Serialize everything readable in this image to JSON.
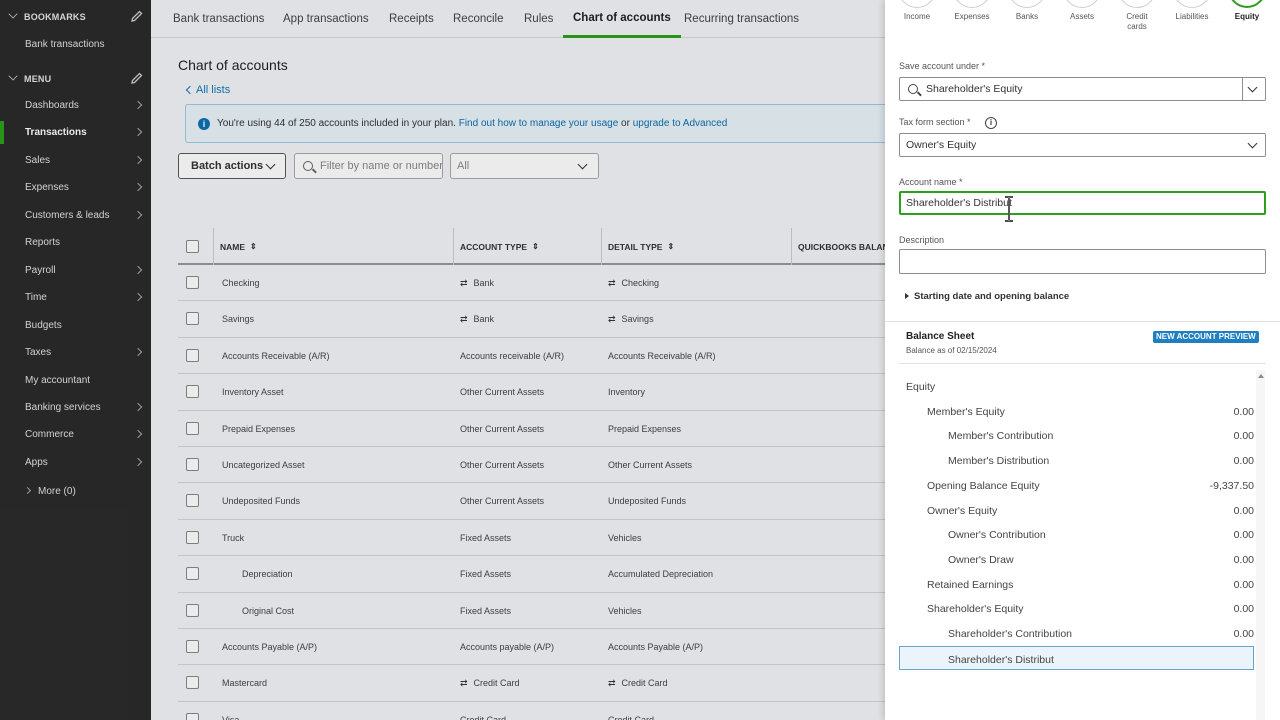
{
  "sidebar": {
    "bookmarks_label": "BOOKMARKS",
    "bookmark_items": [
      "Bank transactions"
    ],
    "menu_label": "MENU",
    "items": [
      {
        "label": "Dashboards",
        "arrow": true
      },
      {
        "label": "Transactions",
        "arrow": true,
        "active": true
      },
      {
        "label": "Sales",
        "arrow": true
      },
      {
        "label": "Expenses",
        "arrow": true
      },
      {
        "label": "Customers & leads",
        "arrow": true
      },
      {
        "label": "Reports",
        "arrow": false
      },
      {
        "label": "Payroll",
        "arrow": true
      },
      {
        "label": "Time",
        "arrow": true
      },
      {
        "label": "Budgets",
        "arrow": false
      },
      {
        "label": "Taxes",
        "arrow": true
      },
      {
        "label": "My accountant",
        "arrow": false
      },
      {
        "label": "Banking services",
        "arrow": true
      },
      {
        "label": "Commerce",
        "arrow": true
      },
      {
        "label": "Apps",
        "arrow": true
      }
    ],
    "more_label": "More (0)"
  },
  "tabs": [
    "Bank transactions",
    "App transactions",
    "Receipts",
    "Reconcile",
    "Rules",
    "Chart of accounts",
    "Recurring transactions"
  ],
  "selected_tab": "Chart of accounts",
  "page": {
    "title": "Chart of accounts",
    "all_lists": "All lists",
    "banner_text": "You're using 44 of 250 accounts included in your plan.",
    "banner_link1": "Find out how to manage your usage",
    "banner_or": "or",
    "banner_link2": "upgrade to Advanced",
    "batch_actions": "Batch actions",
    "filter_placeholder": "Filter by name or number",
    "type_filter_value": "All"
  },
  "table": {
    "headers": [
      "NAME",
      "ACCOUNT TYPE",
      "DETAIL TYPE",
      "QUICKBOOKS BALANCE"
    ],
    "rows": [
      {
        "name": "Checking",
        "type": "Bank",
        "detail": "Checking",
        "bank_icon": true,
        "indent": false
      },
      {
        "name": "Savings",
        "type": "Bank",
        "detail": "Savings",
        "bank_icon": true,
        "indent": false
      },
      {
        "name": "Accounts Receivable (A/R)",
        "type": "Accounts receivable (A/R)",
        "detail": "Accounts Receivable (A/R)",
        "bank_icon": false,
        "indent": false
      },
      {
        "name": "Inventory Asset",
        "type": "Other Current Assets",
        "detail": "Inventory",
        "bank_icon": false,
        "indent": false
      },
      {
        "name": "Prepaid Expenses",
        "type": "Other Current Assets",
        "detail": "Prepaid Expenses",
        "bank_icon": false,
        "indent": false
      },
      {
        "name": "Uncategorized Asset",
        "type": "Other Current Assets",
        "detail": "Other Current Assets",
        "bank_icon": false,
        "indent": false
      },
      {
        "name": "Undeposited Funds",
        "type": "Other Current Assets",
        "detail": "Undeposited Funds",
        "bank_icon": false,
        "indent": false
      },
      {
        "name": "Truck",
        "type": "Fixed Assets",
        "detail": "Vehicles",
        "bank_icon": false,
        "indent": false
      },
      {
        "name": "Depreciation",
        "type": "Fixed Assets",
        "detail": "Accumulated Depreciation",
        "bank_icon": false,
        "indent": true
      },
      {
        "name": "Original Cost",
        "type": "Fixed Assets",
        "detail": "Vehicles",
        "bank_icon": false,
        "indent": true
      },
      {
        "name": "Accounts Payable (A/P)",
        "type": "Accounts payable (A/P)",
        "detail": "Accounts Payable (A/P)",
        "bank_icon": false,
        "indent": false
      },
      {
        "name": "Mastercard",
        "type": "Credit Card",
        "detail": "Credit Card",
        "bank_icon": true,
        "indent": false
      },
      {
        "name": "Visa",
        "type": "Credit Card",
        "detail": "Credit Card",
        "bank_icon": false,
        "indent": false
      }
    ]
  },
  "panel": {
    "categories": [
      {
        "label": "Income"
      },
      {
        "label": "Expenses"
      },
      {
        "label": "Banks"
      },
      {
        "label": "Assets"
      },
      {
        "label": "Credit cards"
      },
      {
        "label": "Liabilities"
      },
      {
        "label": "Equity",
        "selected": true
      }
    ],
    "save_under_label": "Save account under *",
    "save_under_value": "Shareholder's Equity",
    "tax_form_label": "Tax form section *",
    "tax_form_value": "Owner's Equity",
    "account_name_label": "Account name *",
    "account_name_value": "Shareholder's Distribut",
    "description_label": "Description",
    "description_value": "",
    "starting_toggle": "Starting date and opening balance",
    "balance_sheet_title": "Balance Sheet",
    "balance_as_of": "Balance as of 02/15/2024",
    "badge": "NEW ACCOUNT PREVIEW",
    "balance_rows": [
      {
        "name": "Equity",
        "value": "",
        "level": 0
      },
      {
        "name": "Member's Equity",
        "value": "0.00",
        "level": 1
      },
      {
        "name": "Member's Contribution",
        "value": "0.00",
        "level": 2
      },
      {
        "name": "Member's Distribution",
        "value": "0.00",
        "level": 2
      },
      {
        "name": "Opening Balance Equity",
        "value": "-9,337.50",
        "level": 1
      },
      {
        "name": "Owner's Equity",
        "value": "0.00",
        "level": 1
      },
      {
        "name": "Owner's Contribution",
        "value": "0.00",
        "level": 2
      },
      {
        "name": "Owner's Draw",
        "value": "0.00",
        "level": 2
      },
      {
        "name": "Retained Earnings",
        "value": "0.00",
        "level": 1
      },
      {
        "name": "Shareholder's Equity",
        "value": "0.00",
        "level": 1
      },
      {
        "name": "Shareholder's Contribution",
        "value": "0.00",
        "level": 2
      },
      {
        "name": "Shareholder's Distribut",
        "value": "",
        "level": 2,
        "highlighted": true
      }
    ]
  },
  "colors": {
    "accent": "#2ca01c",
    "link": "#0d6fb0",
    "sidebar_bg": "#2b2b2b",
    "badge": "#1f7fc1"
  },
  "icons": [
    "pencil-icon",
    "chevron-down-icon",
    "chevron-right-icon",
    "info-icon",
    "search-icon",
    "sort-icon",
    "bank-icon",
    "text-cursor-icon"
  ]
}
